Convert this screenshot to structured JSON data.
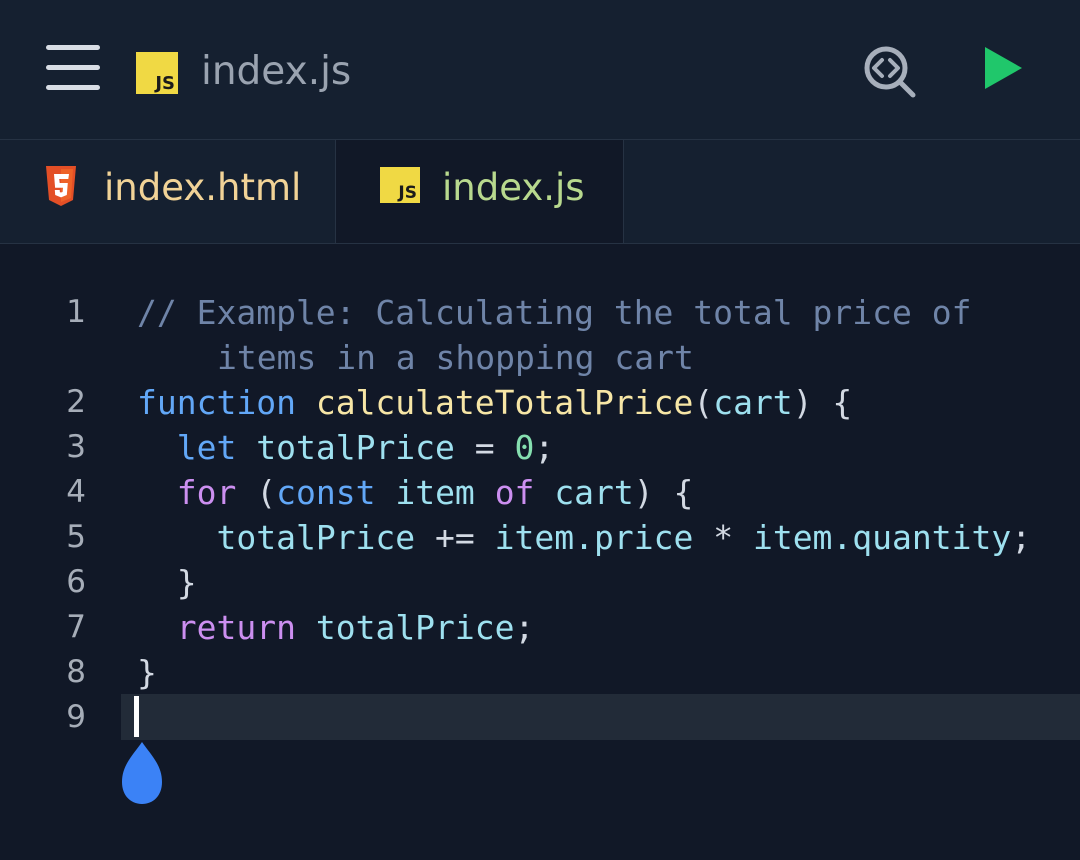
{
  "toolbar": {
    "menu_icon": "hamburger-menu-icon",
    "file_icon": "javascript-file-icon",
    "file_icon_text": "JS",
    "title": "index.js",
    "search_icon": "code-search-icon",
    "run_icon": "run-play-icon"
  },
  "tabs": [
    {
      "label": "index.html",
      "icon": "html5-icon",
      "selected": false
    },
    {
      "label": "index.js",
      "icon": "javascript-file-icon",
      "icon_text": "JS",
      "selected": true
    }
  ],
  "tab_actions": {
    "sort_icon": "sort-lines-icon"
  },
  "editor": {
    "language": "javascript",
    "current_line": "9",
    "lines": [
      {
        "number": "1",
        "segments": [
          {
            "text": "// Example: Calculating the total price of",
            "kind": "comment"
          }
        ],
        "wrap_segments": [
          {
            "text": "items in a shopping cart",
            "kind": "comment"
          }
        ]
      },
      {
        "number": "2",
        "segments": [
          {
            "text": "function",
            "kind": "keyword"
          },
          {
            "text": " ",
            "kind": "punct"
          },
          {
            "text": "calculateTotalPrice",
            "kind": "function-name"
          },
          {
            "text": "(",
            "kind": "punct"
          },
          {
            "text": "cart",
            "kind": "variable"
          },
          {
            "text": ") {",
            "kind": "punct"
          }
        ]
      },
      {
        "number": "3",
        "segments": [
          {
            "text": "  ",
            "kind": "punct"
          },
          {
            "text": "let",
            "kind": "keyword"
          },
          {
            "text": " ",
            "kind": "punct"
          },
          {
            "text": "totalPrice",
            "kind": "variable"
          },
          {
            "text": " = ",
            "kind": "punct"
          },
          {
            "text": "0",
            "kind": "number"
          },
          {
            "text": ";",
            "kind": "punct"
          }
        ]
      },
      {
        "number": "4",
        "segments": [
          {
            "text": "  ",
            "kind": "punct"
          },
          {
            "text": "for",
            "kind": "control"
          },
          {
            "text": " (",
            "kind": "punct"
          },
          {
            "text": "const",
            "kind": "keyword"
          },
          {
            "text": " ",
            "kind": "punct"
          },
          {
            "text": "item",
            "kind": "variable"
          },
          {
            "text": " ",
            "kind": "punct"
          },
          {
            "text": "of",
            "kind": "control"
          },
          {
            "text": " ",
            "kind": "punct"
          },
          {
            "text": "cart",
            "kind": "variable"
          },
          {
            "text": ") {",
            "kind": "punct"
          }
        ]
      },
      {
        "number": "5",
        "segments": [
          {
            "text": "    ",
            "kind": "punct"
          },
          {
            "text": "totalPrice",
            "kind": "variable"
          },
          {
            "text": " += ",
            "kind": "punct"
          },
          {
            "text": "item.price",
            "kind": "variable"
          },
          {
            "text": " * ",
            "kind": "punct"
          },
          {
            "text": "item.quantity",
            "kind": "variable"
          },
          {
            "text": ";",
            "kind": "punct"
          }
        ]
      },
      {
        "number": "6",
        "segments": [
          {
            "text": "  }",
            "kind": "punct"
          }
        ]
      },
      {
        "number": "7",
        "segments": [
          {
            "text": "  ",
            "kind": "punct"
          },
          {
            "text": "return",
            "kind": "control"
          },
          {
            "text": " ",
            "kind": "punct"
          },
          {
            "text": "totalPrice",
            "kind": "variable"
          },
          {
            "text": ";",
            "kind": "punct"
          }
        ]
      },
      {
        "number": "8",
        "segments": [
          {
            "text": "}",
            "kind": "punct"
          }
        ]
      },
      {
        "number": "9",
        "segments": []
      }
    ],
    "cursor_handle_icon": "text-cursor-handle-icon"
  },
  "colors": {
    "background": "#111827",
    "toolbar": "#152030",
    "comment": "#6f84a8",
    "keyword": "#62a7f7",
    "control": "#cc8ff0",
    "function": "#f7e6a6",
    "variable": "#9ee0ef",
    "number": "#86dfb0",
    "run": "#20c76b",
    "html5": "#e34f26",
    "javascript": "#f0d944",
    "cursor_handle": "#3b82f6"
  }
}
